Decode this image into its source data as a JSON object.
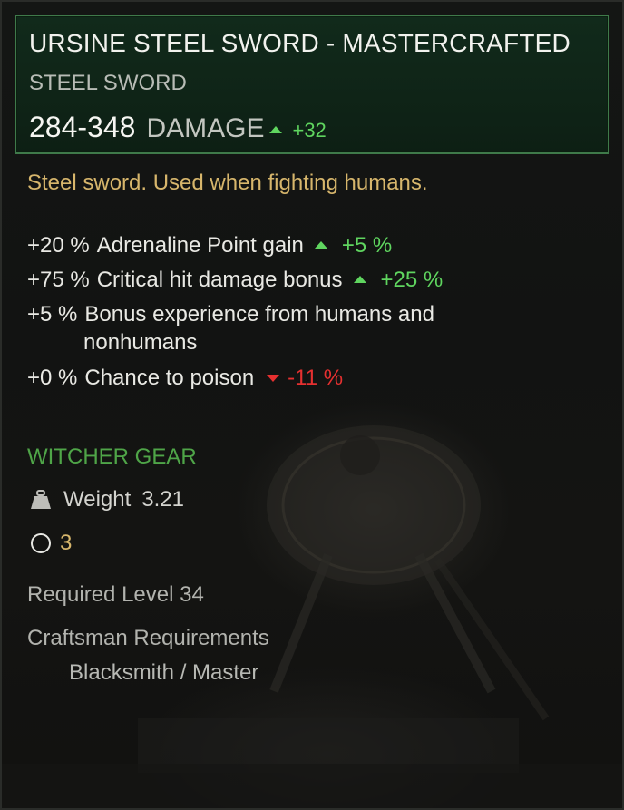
{
  "item": {
    "name": "URSINE STEEL SWORD - MASTERCRAFTED",
    "type": "STEEL SWORD",
    "damage": {
      "value": "284-348",
      "label": "DAMAGE",
      "delta": "+32",
      "trend": "up"
    },
    "description": "Steel sword. Used when fighting humans.",
    "attributes": [
      {
        "value": "+20 %",
        "label": "Adrenaline Point gain",
        "delta": "+5 %",
        "trend": "up"
      },
      {
        "value": "+75 %",
        "label": "Critical hit damage bonus",
        "delta": "+25 %",
        "trend": "up"
      },
      {
        "value": "+5 %",
        "label_line1": "Bonus experience from humans and",
        "label_line2": "nonhumans"
      },
      {
        "value": "+0 %",
        "label": "Chance to poison",
        "delta": "-11 %",
        "trend": "down"
      }
    ],
    "category": "WITCHER GEAR",
    "weight": {
      "icon": "weight-icon",
      "label": "Weight",
      "value": "3.21"
    },
    "slots": {
      "icon": "enhancement-slot-icon",
      "count": "3"
    },
    "required_level": "Required Level 34",
    "craftsman": {
      "label": "Craftsman Requirements",
      "value": "Blacksmith / Master"
    }
  },
  "colors": {
    "header_border": "#3f7a4a",
    "header_bg": "#112a1b",
    "description": "#d7b66c",
    "positive": "#5fd55f",
    "negative": "#e63030",
    "gear": "#4fa548",
    "text": "#e9e9e4",
    "muted": "#b2b3ae"
  }
}
